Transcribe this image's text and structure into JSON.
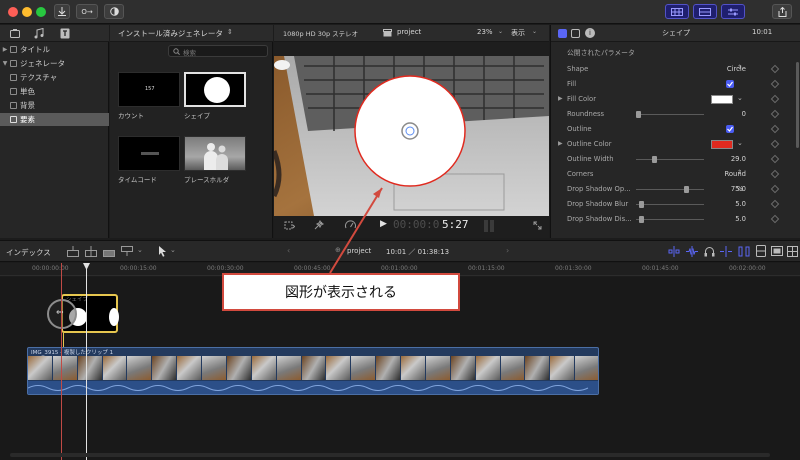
{
  "toolbar": {
    "import_icon": "download-arrow",
    "keyword_button": "O→",
    "view_buttons": [
      "browser-layout",
      "timeline-layout",
      "inspector-layout"
    ],
    "share_icon": "share"
  },
  "library": {
    "items": [
      {
        "label": "タイトル",
        "level": 0,
        "selected": false
      },
      {
        "label": "ジェネレータ",
        "level": 0,
        "selected": false
      },
      {
        "label": "テクスチャ",
        "level": 1,
        "selected": false
      },
      {
        "label": "単色",
        "level": 1,
        "selected": false
      },
      {
        "label": "背景",
        "level": 1,
        "selected": false
      },
      {
        "label": "要素",
        "level": 1,
        "selected": true
      }
    ]
  },
  "browser": {
    "title": "インストール済みジェネレータ",
    "search_placeholder": "検索",
    "items": [
      {
        "label": "カウント",
        "preview_text": "157",
        "selected": false
      },
      {
        "label": "シェイプ",
        "preview_text": "",
        "selected": true
      },
      {
        "label": "タイムコード",
        "preview_text": "",
        "selected": false
      },
      {
        "label": "プレースホルダ",
        "preview_text": "",
        "selected": false
      }
    ]
  },
  "viewer": {
    "format": "1080p HD 30p ステレオ",
    "project": "project",
    "zoom": "23%",
    "view_menu": "表示",
    "timecode_dim": "00:00:0",
    "timecode": "5:27"
  },
  "inspector": {
    "title": "シェイプ",
    "time": "10:01",
    "section": "公開されたパラメータ",
    "params": [
      {
        "label": "Shape",
        "value": "Circle",
        "kind": "popup"
      },
      {
        "label": "Fill",
        "value": "",
        "kind": "checkbox",
        "checked": true
      },
      {
        "label": "Fill Color",
        "value": "#ffffff",
        "kind": "color"
      },
      {
        "label": "Roundness",
        "value": "0",
        "kind": "slider",
        "level": 0.0
      },
      {
        "label": "Outline",
        "value": "",
        "kind": "checkbox",
        "checked": true
      },
      {
        "label": "Outline Color",
        "value": "#e02a1f",
        "kind": "color"
      },
      {
        "label": "Outline Width",
        "value": "29.0",
        "kind": "slider",
        "level": 0.25
      },
      {
        "label": "Corners",
        "value": "Round",
        "kind": "popup"
      },
      {
        "label": "Drop Shadow Op...",
        "value": "75.0",
        "unit": "%",
        "kind": "slider",
        "level": 0.75
      },
      {
        "label": "Drop Shadow Blur",
        "value": "5.0",
        "kind": "slider",
        "level": 0.05
      },
      {
        "label": "Drop Shadow Dis...",
        "value": "5.0",
        "kind": "slider",
        "level": 0.05
      }
    ]
  },
  "timeline": {
    "index_label": "インデックス",
    "project": "project",
    "duration": "10:01 ／ 01:38:13",
    "ruler": [
      "00:00:00:00",
      "00:00:15:00",
      "00:00:30:00",
      "00:00:45:00",
      "00:01:00:00",
      "00:01:15:00",
      "00:01:30:00",
      "00:01:45:00",
      "00:02:00:00"
    ],
    "generator_clip": "シェイプ",
    "video_clip": "IMG_3915 - 複製したクリップ 1"
  },
  "annotation": {
    "callout": "図形が表示される"
  },
  "colors": {
    "accent": "#5a66f5",
    "outline_red": "#e02a1f",
    "callout_border": "#d24a3e",
    "clip_yellow": "#e6c64f"
  }
}
